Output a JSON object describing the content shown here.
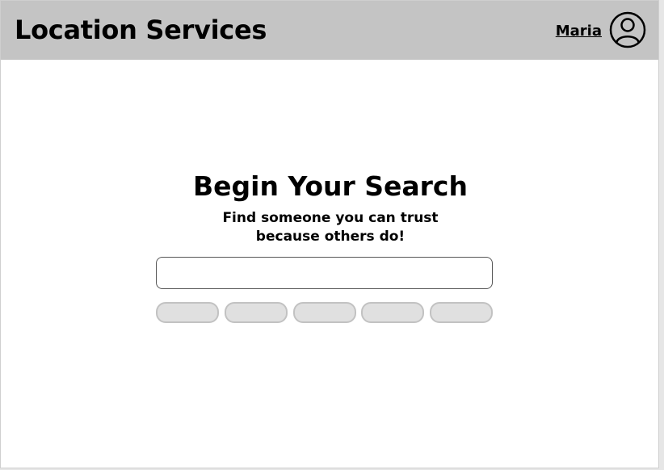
{
  "header": {
    "title": "Location Services",
    "user_name": "Maria",
    "user_icon": "user-circle-icon"
  },
  "main": {
    "heading": "Begin Your Search",
    "subtitle_line1": "Find someone you can trust",
    "subtitle_line2": "because others do!",
    "search": {
      "value": "",
      "placeholder": ""
    },
    "filter_chips": [
      {
        "label": ""
      },
      {
        "label": ""
      },
      {
        "label": ""
      },
      {
        "label": ""
      },
      {
        "label": ""
      }
    ]
  },
  "colors": {
    "header_bg": "#c4c4c4",
    "page_bg": "#ffffff",
    "chip_bg": "#e0e0e0",
    "chip_border": "#c2c2c2"
  }
}
